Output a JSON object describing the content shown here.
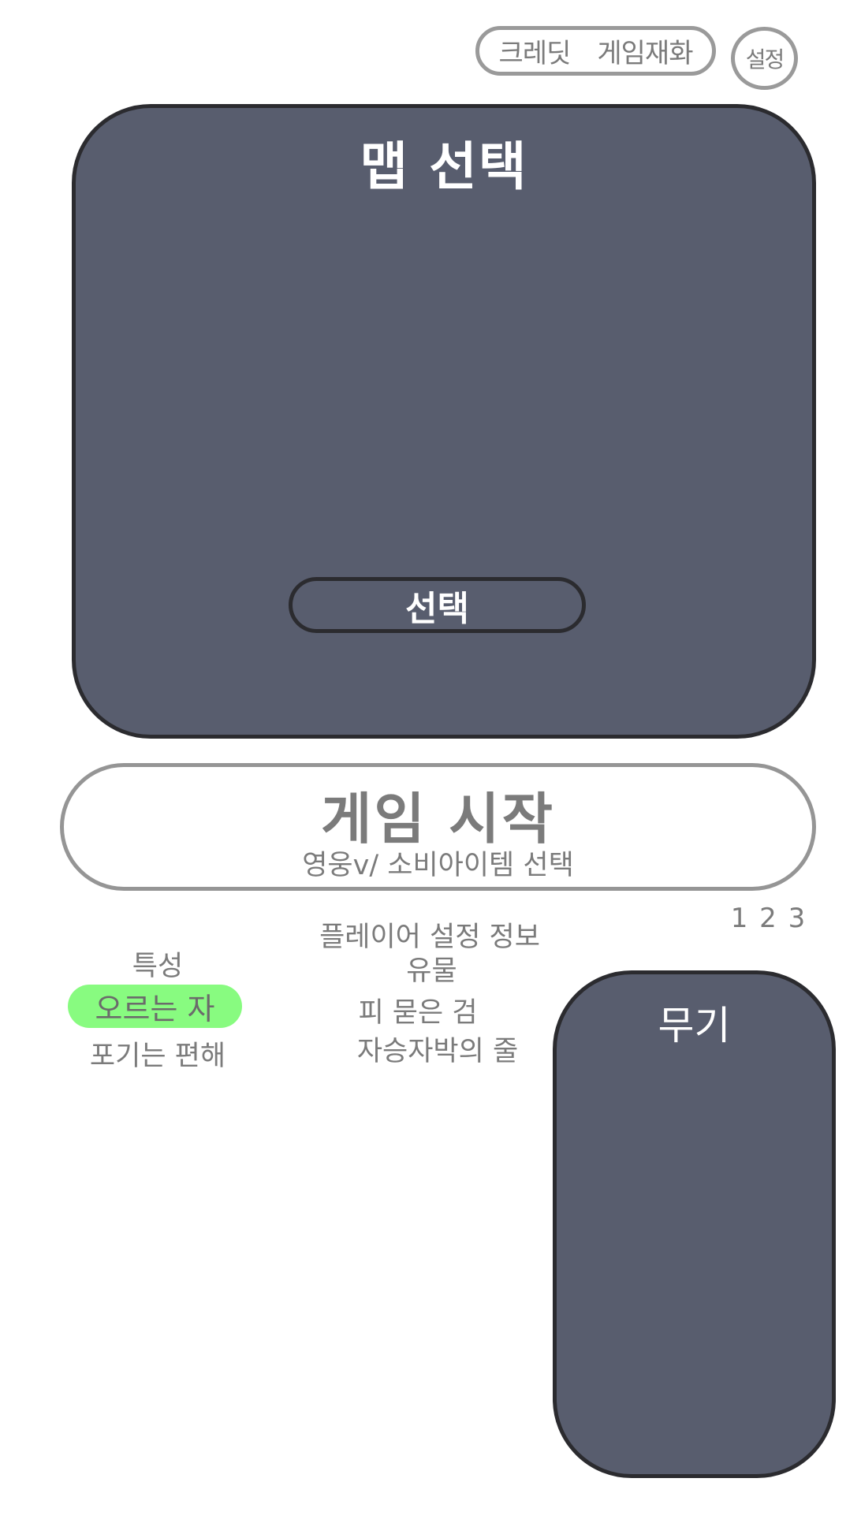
{
  "top_bar": {
    "credit_label": "크레딧",
    "currency_label": "게임재화",
    "settings_label": "설정"
  },
  "map_select": {
    "title": "맵 선택",
    "select_button": "선택"
  },
  "start_game": {
    "title": "게임 시작",
    "subtitle": "영웅v/ 소비아이템 선택"
  },
  "pages_label": "1 2 3",
  "traits": {
    "heading": "특성",
    "items": [
      "오르는 자",
      "포기는 편해"
    ],
    "selected_index": 0
  },
  "player_info": {
    "label": "플레이어 설정 정보",
    "relic_heading": "유물",
    "relics": [
      "피 묻은 검",
      "자승자박의 줄"
    ]
  },
  "weapon": {
    "title": "무기"
  },
  "colors": {
    "panel_fill": "#585d6e",
    "panel_border": "#2b2b2f",
    "text_gray": "#7b7b7b",
    "highlight_green": "#88fb80"
  }
}
